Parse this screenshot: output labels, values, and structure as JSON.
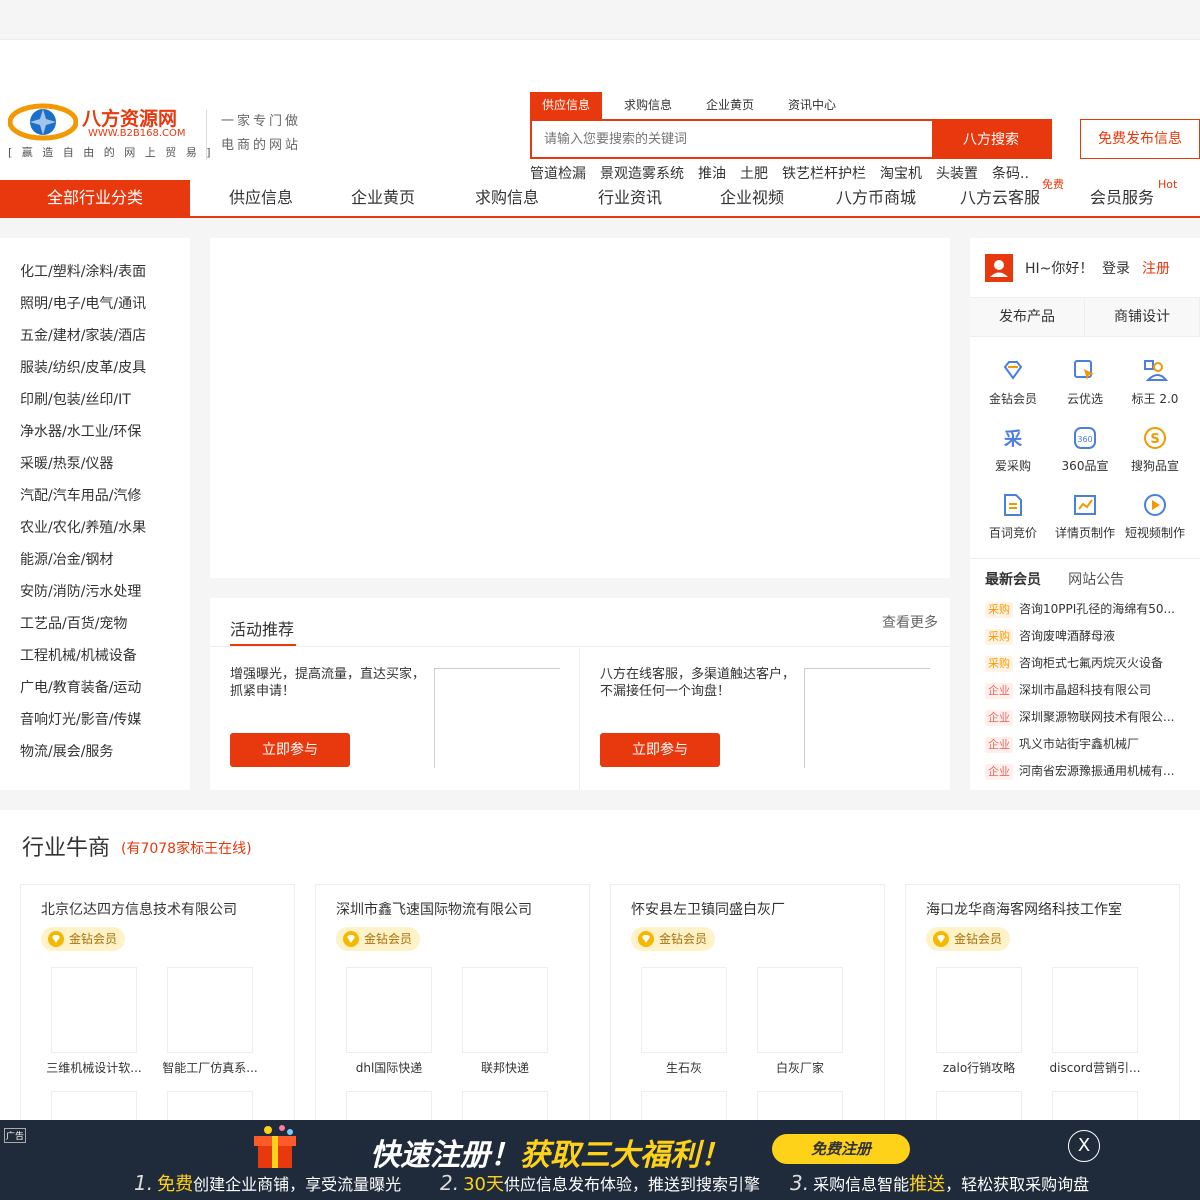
{
  "header": {
    "logo": {
      "name": "八方资源网",
      "url": "WWW.B2B168.COM",
      "slogan": "[ 赢 造 自 由 的 网 上 贸 易 ]"
    },
    "tagline": [
      "一家专门做",
      "电商的网站"
    ],
    "search_tabs": [
      "供应信息",
      "求购信息",
      "企业黄页",
      "资讯中心"
    ],
    "search_placeholder": "请输入您要搜索的关键词",
    "search_button": "八方搜索",
    "free_post": "免费发布信息",
    "hotwords": [
      "管道检漏",
      "景观造雾系统",
      "推油",
      "土肥",
      "铁艺栏杆护栏",
      "淘宝机",
      "头装置",
      "条码.."
    ]
  },
  "nav": {
    "all_categories": "全部行业分类",
    "items": [
      "供应信息",
      "企业黄页",
      "求购信息",
      "行业资讯",
      "企业视频",
      "八方币商城",
      "八方云客服",
      "会员服务"
    ],
    "badge_free": "免费",
    "badge_hot": "Hot"
  },
  "categories": [
    "化工/塑料/涂料/表面",
    "照明/电子/电气/通讯",
    "五金/建材/家装/酒店",
    "服装/纺织/皮革/皮具",
    "印刷/包装/丝印/IT",
    "净水器/水工业/环保",
    "采暖/热泵/仪器",
    "汽配/汽车用品/汽修",
    "农业/农化/养殖/水果",
    "能源/冶金/钢材",
    "安防/消防/污水处理",
    "工艺品/百货/宠物",
    "工程机械/机械设备",
    "广电/教育装备/运动",
    "音响灯光/影音/传媒",
    "物流/展会/服务"
  ],
  "activity": {
    "title": "活动推荐",
    "more": "查看更多",
    "cards": [
      {
        "text": "增强曝光，提高流量，直达买家，抓紧申请！",
        "button": "立即参与"
      },
      {
        "text": "八方在线客服，多渠道触达客户，不漏接任何一个询盘！",
        "button": "立即参与"
      }
    ]
  },
  "sidebar": {
    "greeting": "HI~你好！",
    "login": "登录",
    "register": "注册",
    "tabs": [
      "发布产品",
      "商铺设计"
    ],
    "tools": [
      {
        "label": "金钻会员",
        "icon": "diamond-icon"
      },
      {
        "label": "云优选",
        "icon": "cursor-icon"
      },
      {
        "label": "标王 2.0",
        "icon": "crown-user-icon"
      },
      {
        "label": "爱采购",
        "icon": "cai-icon"
      },
      {
        "label": "360品宣",
        "icon": "360-icon"
      },
      {
        "label": "搜狗品宣",
        "icon": "sogou-icon"
      },
      {
        "label": "百词竞价",
        "icon": "document-icon"
      },
      {
        "label": "详情页制作",
        "icon": "chart-icon"
      },
      {
        "label": "短视频制作",
        "icon": "play-icon"
      }
    ],
    "news_tabs": [
      "最新会员",
      "网站公告"
    ],
    "news": [
      {
        "tag": "采购",
        "text": "咨询10PPI孔径的海绵有50..."
      },
      {
        "tag": "采购",
        "text": "咨询废啤酒酵母液"
      },
      {
        "tag": "采购",
        "text": "咨询柜式七氟丙烷灭火设备"
      },
      {
        "tag": "企业",
        "text": "深圳市晶超科技有限公司"
      },
      {
        "tag": "企业",
        "text": "深圳聚源物联网技术有限公..."
      },
      {
        "tag": "企业",
        "text": "巩义市站街宇鑫机械厂"
      },
      {
        "tag": "企业",
        "text": "河南省宏源豫振通用机械有..."
      }
    ]
  },
  "merchants": {
    "title": "行业牛商",
    "count": "(有7078家标王在线)",
    "badge": "金钻会员",
    "cards": [
      {
        "name": "北京亿达四方信息技术有限公司",
        "products": [
          "三维机械设计软...",
          "智能工厂仿真系..."
        ]
      },
      {
        "name": "深圳市鑫飞速国际物流有限公司",
        "products": [
          "dhl国际快递",
          "联邦快递"
        ]
      },
      {
        "name": "怀安县左卫镇同盛白灰厂",
        "products": [
          "生石灰",
          "白灰厂家"
        ]
      },
      {
        "name": "海口龙华商海客网络科技工作室",
        "products": [
          "zalo行销攻略",
          "discord营销引..."
        ]
      }
    ]
  },
  "ad": {
    "label": "广告",
    "headline_a": "快速注册！",
    "headline_b": "获取三大福利！",
    "register": "免费注册",
    "close": "X",
    "items": [
      {
        "n": "1.",
        "hl": "免费",
        "text": "创建企业商铺，享受流量曝光"
      },
      {
        "n": "2.",
        "hl": "30天",
        "text": "供应信息发布体验，推送到搜索引擎"
      },
      {
        "n": "3.",
        "pre": "采购信息智能",
        "hl": "推送",
        "text": "，轻松获取采购询盘"
      }
    ]
  },
  "colors": {
    "accent": "#e8380d",
    "ad_bg": "#1f2a3a",
    "ad_yellow": "#ffd21a"
  }
}
